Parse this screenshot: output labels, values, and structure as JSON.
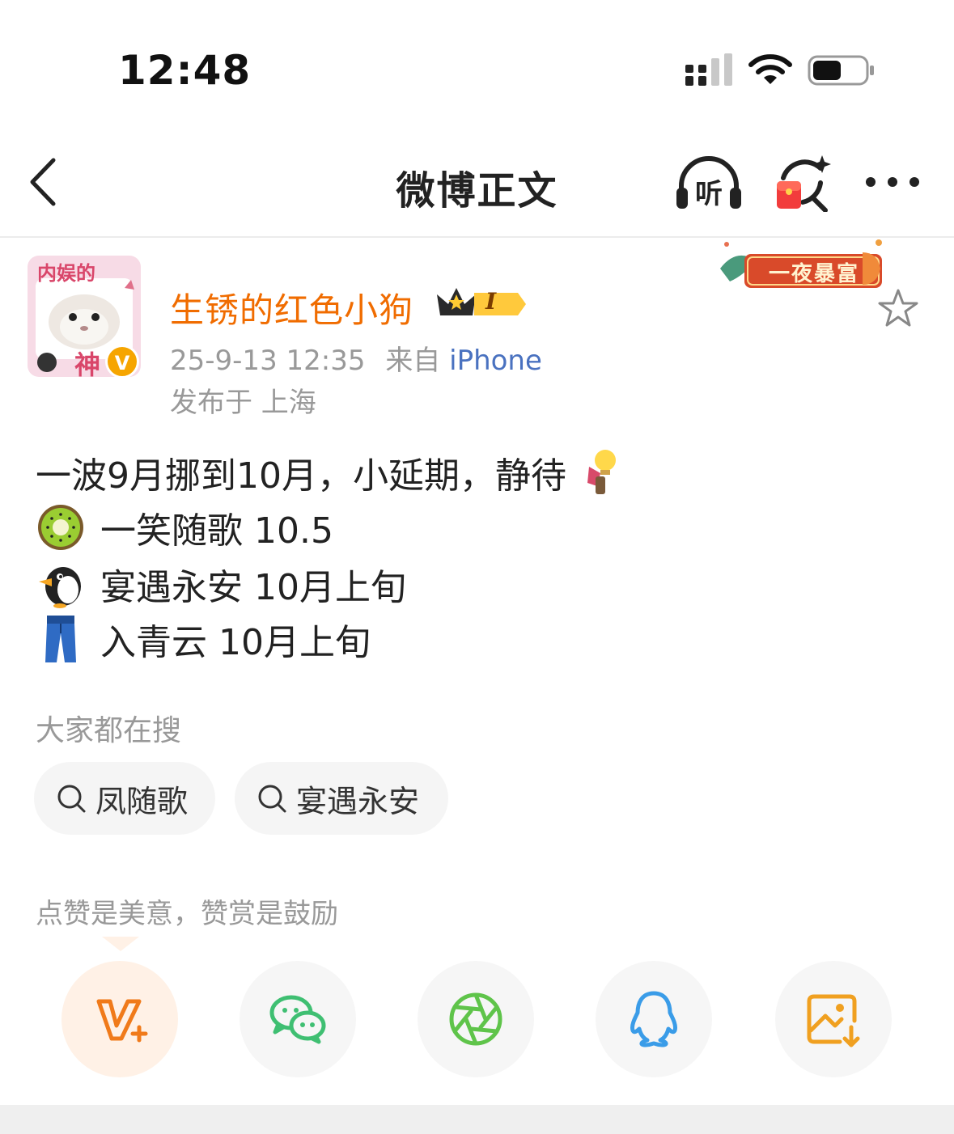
{
  "status_bar": {
    "time": "12:48",
    "signal_icon": "cellular-signal-icon",
    "wifi_icon": "wifi-icon",
    "battery_icon": "battery-icon"
  },
  "nav": {
    "title": "微博正文",
    "back_icon": "chevron-left-icon",
    "listen_label": "听",
    "redpacket_icon": "red-packet-search-icon",
    "more_icon": "more-horizontal-icon"
  },
  "post": {
    "author": {
      "name": "生锈的红色小狗",
      "avatar_caption_top": "内娱的",
      "avatar_caption_bottom": "神",
      "verified_mark": "V",
      "vip_level": "I"
    },
    "timestamp": "25-9-13 12:35",
    "source_prefix": "来自",
    "source": "iPhone",
    "location": "发布于 上海",
    "banner_text": "一夜暴富",
    "lines": [
      {
        "emoji": "",
        "text": "一波9月挪到10月，小延期，静待",
        "trailing_emoji": "lightbulb-figure-emoji"
      },
      {
        "emoji": "kiwi-emoji",
        "text": "一笑随歌 10.5"
      },
      {
        "emoji": "penguin-emoji",
        "text": "宴遇永安 10月上旬"
      },
      {
        "emoji": "jeans-emoji",
        "text": "入青云 10月上旬"
      }
    ]
  },
  "trending": {
    "title": "大家都在搜",
    "chips": [
      {
        "label": "凤随歌"
      },
      {
        "label": "宴遇永安"
      }
    ]
  },
  "reward": {
    "text": "点赞是美意，赞赏是鼓励",
    "buttons": [
      {
        "icon": "v-plus-icon",
        "color": "#f07a1a"
      },
      {
        "icon": "wechat-icon",
        "color": "#3fbf72"
      },
      {
        "icon": "moments-icon",
        "color": "#5fc44a"
      },
      {
        "icon": "qq-icon",
        "color": "#3a9ce8"
      },
      {
        "icon": "save-image-icon",
        "color": "#f0a020"
      }
    ]
  },
  "colors": {
    "username": "#f06c00",
    "link": "#4a72c0",
    "meta": "#999999"
  }
}
